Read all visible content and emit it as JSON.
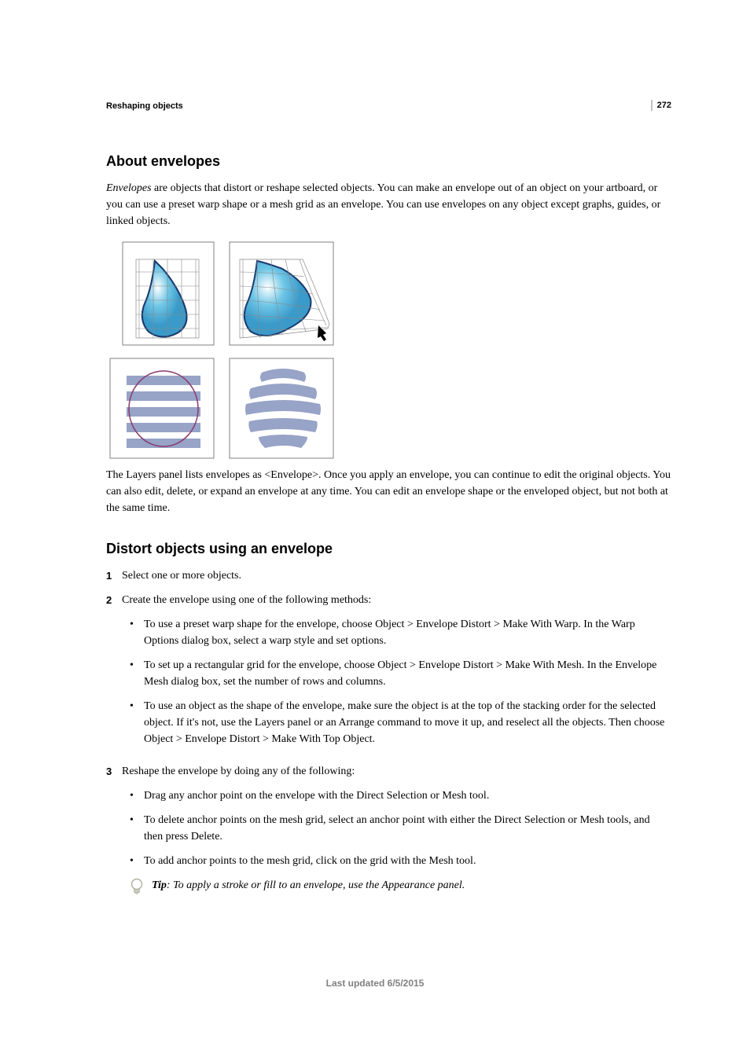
{
  "page_number": "272",
  "chapter_header": "Reshaping objects",
  "h2_about": "About envelopes",
  "p_envelopes_intro_em": "Envelopes",
  "p_envelopes_intro": " are objects that distort or reshape selected objects. You can make an envelope out of an object on your artboard, or you can use a preset warp shape or a mesh grid as an envelope. You can use envelopes on any object except graphs, guides, or linked objects.",
  "p_caption": "The Layers panel lists envelopes as <Envelope>. Once you apply an envelope, you can continue to edit the original objects. You can also edit, delete, or expand an envelope at any time. You can edit an envelope shape or the enveloped object, but not both at the same time.",
  "h2_distort": "Distort objects using an envelope",
  "n1": "1",
  "step1": "Select one or more objects.",
  "n2": "2",
  "step2": "Create the envelope using one of the following methods:",
  "step2_b1": "To use a preset warp shape for the envelope, choose Object > Envelope Distort > Make With Warp. In the Warp Options dialog box, select a warp style and set options.",
  "step2_b2": "To set up a rectangular grid for the envelope, choose Object > Envelope Distort > Make With Mesh. In the Envelope Mesh dialog box, set the number of rows and columns.",
  "step2_b3": "To use an object as the shape of the envelope, make sure the object is at the top of the stacking order for the selected object. If it's not, use the Layers panel or an Arrange command to move it up, and reselect all the objects. Then choose Object > Envelope Distort > Make With Top Object.",
  "n3": "3",
  "step3": "Reshape the envelope by doing any of the following:",
  "step3_b1": "Drag any anchor point on the envelope with the Direct Selection or Mesh tool.",
  "step3_b2": "To delete anchor points on the mesh grid, select an anchor point with either the Direct Selection or Mesh tools, and then press Delete.",
  "step3_b3": "To add anchor points to the mesh grid, click on the grid with the Mesh tool.",
  "tip_label": "Tip",
  "tip_text": ": To apply a stroke or fill to an envelope, use the Appearance panel.",
  "footer": "Last updated 6/5/2015"
}
